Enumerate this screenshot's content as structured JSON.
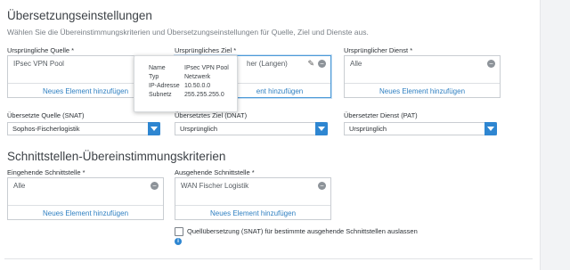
{
  "section1": {
    "title": "Übersetzungseinstellungen",
    "subtitle": "Wählen Sie die Übereinstimmungskriterien und Übersetzungseinstellungen für Quelle, Ziel und Dienste aus.",
    "orig_source": {
      "label": "Ursprüngliche Quelle *",
      "item": "IPsec VPN Pool",
      "add": "Neues Element hinzufügen"
    },
    "orig_dest": {
      "label": "Ursprüngliches Ziel *",
      "item": "her (Langen)",
      "add": "ent hinzufügen"
    },
    "orig_service": {
      "label": "Ursprünglicher Dienst *",
      "item": "Alle",
      "add": "Neues Element hinzufügen"
    },
    "trans_source": {
      "label": "Übersetzte Quelle (SNAT)",
      "value": "Sophos-Fischerlogistik"
    },
    "trans_dest": {
      "label": "Übersetztes Ziel (DNAT)",
      "value": "Ursprünglich"
    },
    "trans_service": {
      "label": "Übersetzter Dienst (PAT)",
      "value": "Ursprünglich"
    }
  },
  "tooltip": {
    "rows": [
      {
        "key": "Name",
        "value": "IPsec VPN Pool"
      },
      {
        "key": "Typ",
        "value": "Netzwerk"
      },
      {
        "key": "IP-Adresse",
        "value": "10.50.0.0"
      },
      {
        "key": "Subnetz",
        "value": "255.255.255.0"
      }
    ]
  },
  "section2": {
    "title": "Schnittstellen-Übereinstimmungskriterien",
    "inbound": {
      "label": "Eingehende Schnittstelle *",
      "item": "Alle",
      "add": "Neues Element hinzufügen"
    },
    "outbound": {
      "label": "Ausgehende Schnittstelle *",
      "item": "WAN Fischer Logistik",
      "add": "Neues Element hinzufügen"
    },
    "checkbox_label": "Quellübersetzung (SNAT) für bestimmte ausgehende Schnittstellen auslassen",
    "info_glyph": "i"
  },
  "colors": {
    "accent": "#2e86d1",
    "link": "#2e7fc1"
  }
}
